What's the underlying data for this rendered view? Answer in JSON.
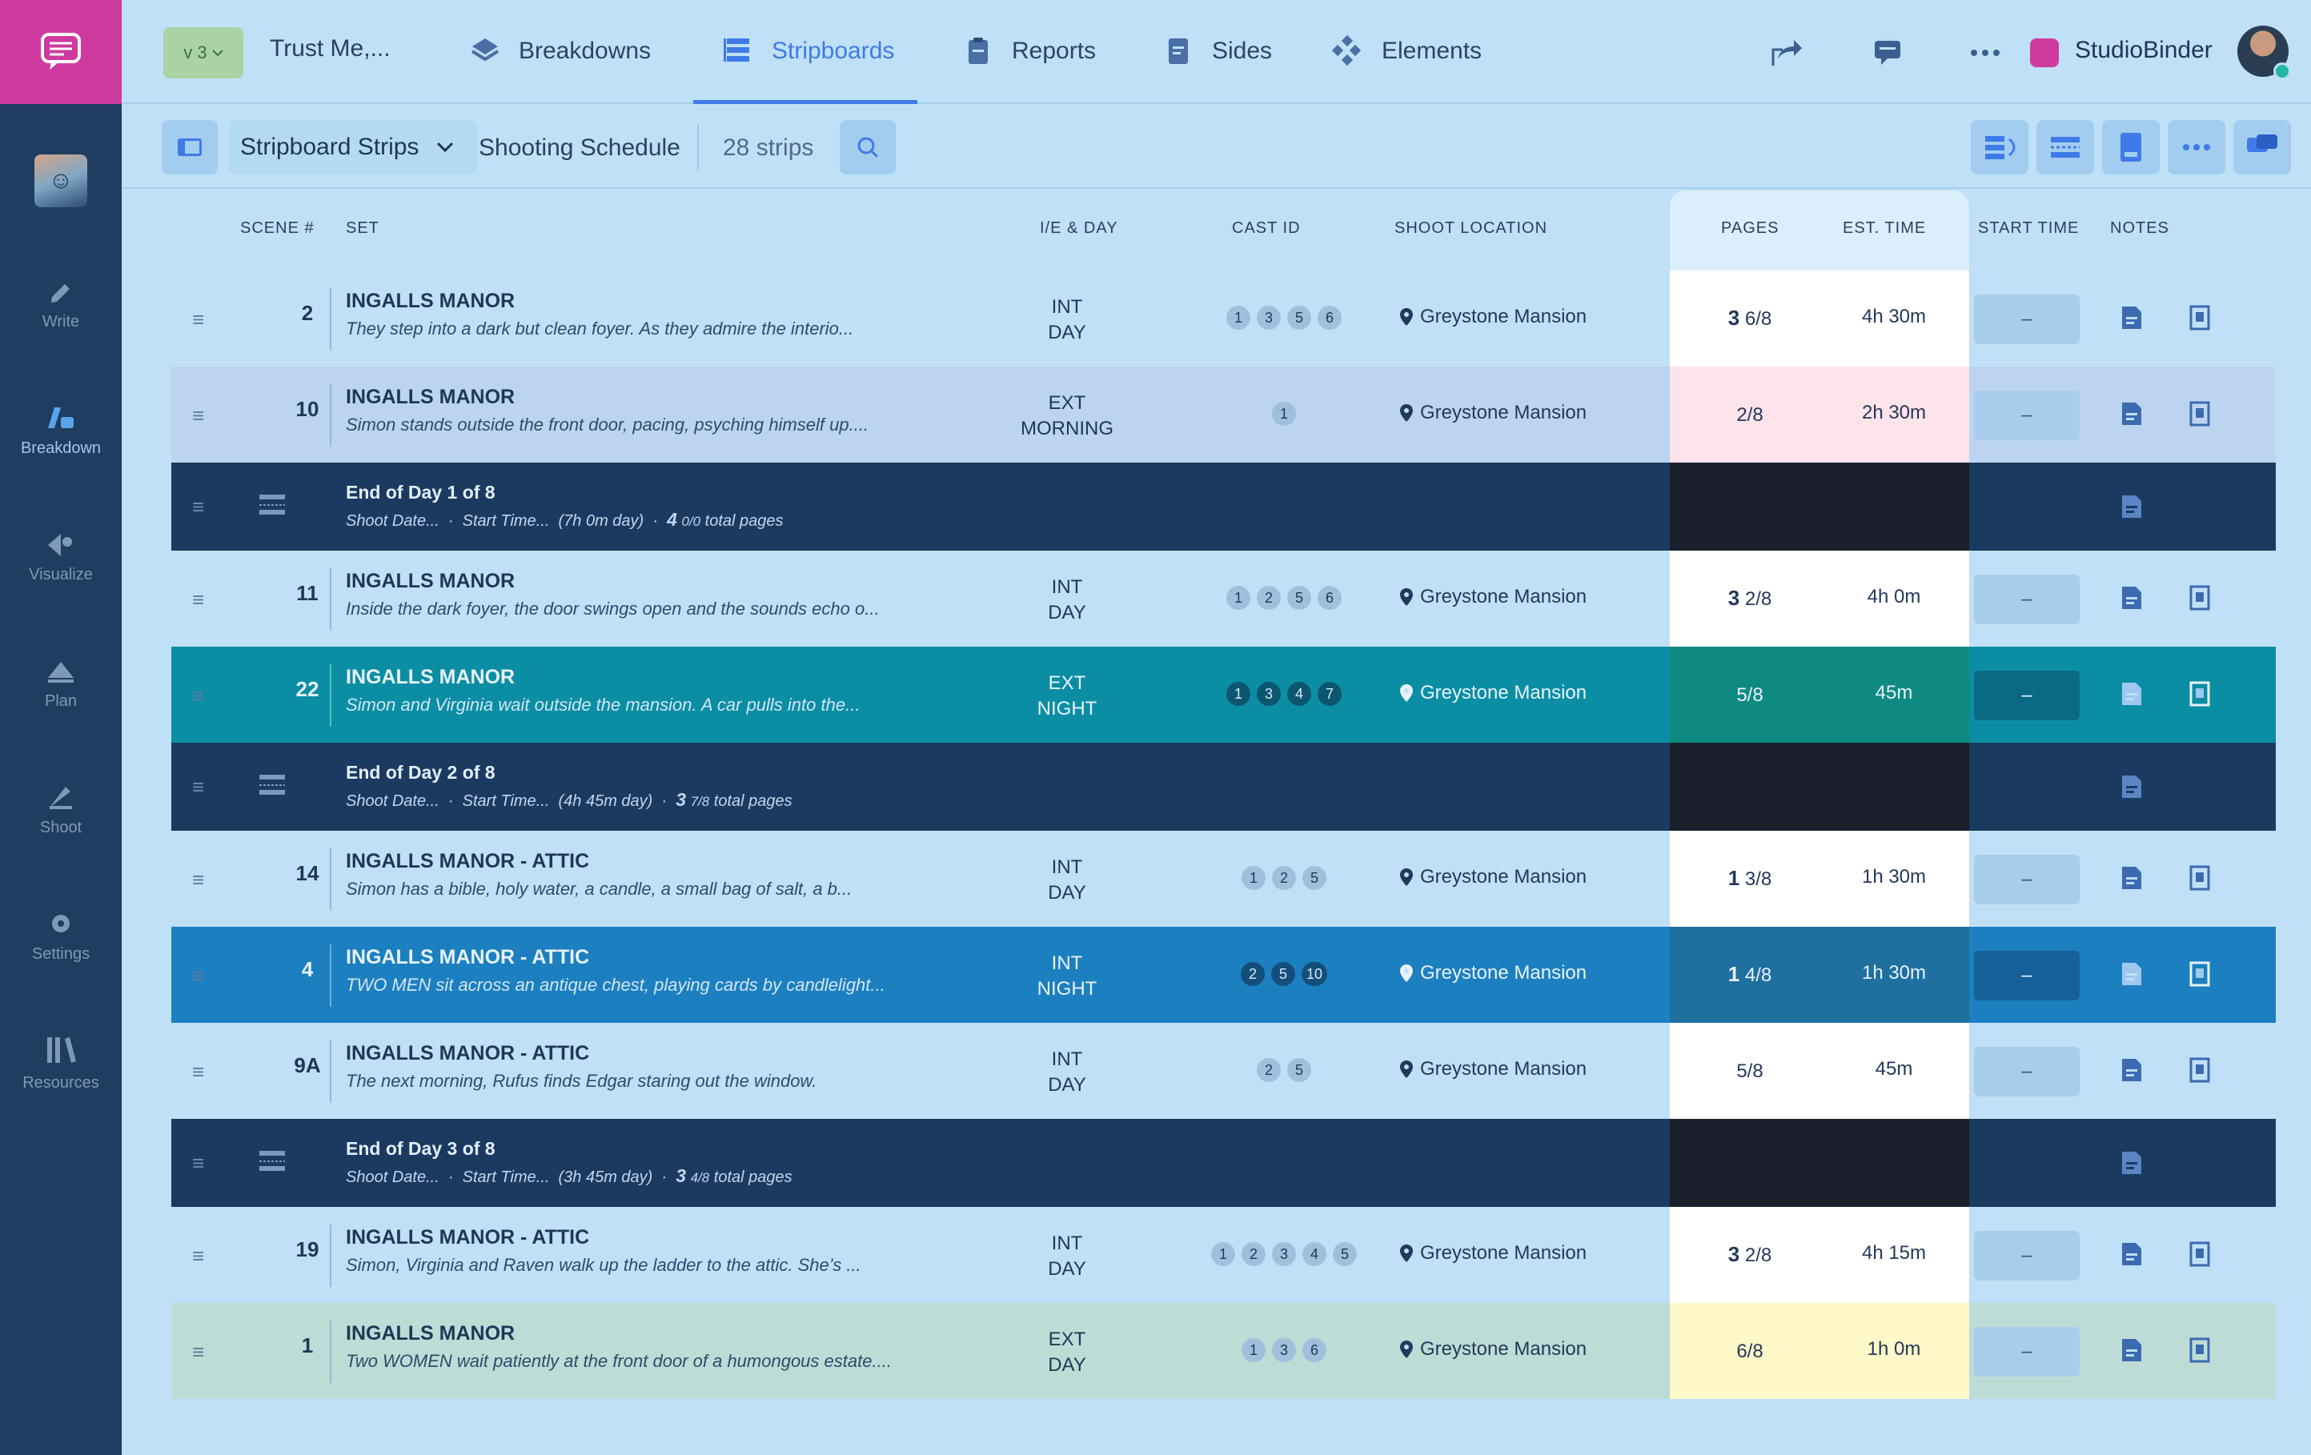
{
  "app": {
    "version": "v 3",
    "project": "Trust Me,..."
  },
  "tabs": [
    {
      "label": "Breakdowns"
    },
    {
      "label": "Stripboards"
    },
    {
      "label": "Reports"
    },
    {
      "label": "Sides"
    },
    {
      "label": "Elements"
    }
  ],
  "workspace": "StudioBinder",
  "nav": [
    {
      "label": "Write"
    },
    {
      "label": "Breakdown"
    },
    {
      "label": "Visualize"
    },
    {
      "label": "Plan"
    },
    {
      "label": "Shoot"
    },
    {
      "label": "Settings"
    },
    {
      "label": "Resources"
    }
  ],
  "toolbar": {
    "view": "Stripboard Strips",
    "schedule": "Shooting Schedule",
    "count": "28 strips"
  },
  "columns": {
    "scene": "SCENE #",
    "set": "SET",
    "ie": "I/E & DAY",
    "cast": "CAST ID",
    "location": "SHOOT LOCATION",
    "pages": "PAGES",
    "est": "EST. TIME",
    "start": "START TIME",
    "notes": "NOTES"
  },
  "rows": [
    {
      "kind": "scene",
      "scene": "2",
      "set": "INGALLS MANOR",
      "desc": "They step into a dark but clean foyer. As they admire the interio...",
      "ie": "INT",
      "time": "DAY",
      "cast": [
        "1",
        "3",
        "5",
        "6"
      ],
      "location": "Greystone Mansion",
      "pages_whole": "3",
      "pages_frac": "6/8",
      "est": "4h 30m",
      "start": "–",
      "bg": "#bfe0f7",
      "pages_bg": "#ffffff",
      "dark": false
    },
    {
      "kind": "scene",
      "scene": "10",
      "set": "INGALLS MANOR",
      "desc": "Simon stands outside the front door, pacing, psyching himself up....",
      "ie": "EXT",
      "time": "MORNING",
      "cast": [
        "1"
      ],
      "location": "Greystone Mansion",
      "pages_whole": "",
      "pages_frac": "2/8",
      "est": "2h 30m",
      "start": "–",
      "bg": "#bdd4f1",
      "pages_bg": "#fde3ea",
      "dark": false
    },
    {
      "kind": "break",
      "title": "End of  Day 1 of 8",
      "shoot_date": "Shoot Date...",
      "start_time": "Start Time...",
      "duration": "(7h 0m day)",
      "total_whole": "4",
      "total_frac": "0/0",
      "total_label": "total pages"
    },
    {
      "kind": "scene",
      "scene": "11",
      "set": "INGALLS MANOR",
      "desc": "Inside the dark foyer, the door swings open and the sounds echo o...",
      "ie": "INT",
      "time": "DAY",
      "cast": [
        "1",
        "2",
        "5",
        "6"
      ],
      "location": "Greystone Mansion",
      "pages_whole": "3",
      "pages_frac": "2/8",
      "est": "4h 0m",
      "start": "–",
      "bg": "#bfe0f7",
      "pages_bg": "#ffffff",
      "dark": false
    },
    {
      "kind": "scene",
      "scene": "22",
      "set": "INGALLS MANOR",
      "desc": "Simon and Virginia wait outside the mansion. A car pulls into the...",
      "ie": "EXT",
      "time": "NIGHT",
      "cast": [
        "1",
        "3",
        "4",
        "7"
      ],
      "location": "Greystone Mansion",
      "pages_whole": "",
      "pages_frac": "5/8",
      "est": "45m",
      "start": "–",
      "bg": "#0b8ea3",
      "pages_bg": "#0f8a83",
      "dark": true
    },
    {
      "kind": "break",
      "title": "End of  Day 2 of 8",
      "shoot_date": "Shoot Date...",
      "start_time": "Start Time...",
      "duration": "(4h 45m day)",
      "total_whole": "3",
      "total_frac": "7/8",
      "total_label": "total pages"
    },
    {
      "kind": "scene",
      "scene": "14",
      "set": "INGALLS MANOR - ATTIC",
      "desc": "Simon has a bible, holy water, a candle, a small bag of salt, a b...",
      "ie": "INT",
      "time": "DAY",
      "cast": [
        "1",
        "2",
        "5"
      ],
      "location": "Greystone Mansion",
      "pages_whole": "1",
      "pages_frac": "3/8",
      "est": "1h 30m",
      "start": "–",
      "bg": "#bfe0f7",
      "pages_bg": "#ffffff",
      "dark": false
    },
    {
      "kind": "scene",
      "scene": "4",
      "set": "INGALLS MANOR - ATTIC",
      "desc": "TWO MEN sit across an antique chest, playing cards by candlelight...",
      "ie": "INT",
      "time": "NIGHT",
      "cast": [
        "2",
        "5",
        "10"
      ],
      "location": "Greystone Mansion",
      "pages_whole": "1",
      "pages_frac": "4/8",
      "est": "1h 30m",
      "start": "–",
      "bg": "#1c7fbf",
      "pages_bg": "#1f6f9f",
      "dark": true
    },
    {
      "kind": "scene",
      "scene": "9A",
      "set": "INGALLS MANOR - ATTIC",
      "desc": "The next morning, Rufus finds Edgar staring out the window.",
      "ie": "INT",
      "time": "DAY",
      "cast": [
        "2",
        "5"
      ],
      "location": "Greystone Mansion",
      "pages_whole": "",
      "pages_frac": "5/8",
      "est": "45m",
      "start": "–",
      "bg": "#bfe0f7",
      "pages_bg": "#ffffff",
      "dark": false
    },
    {
      "kind": "break",
      "title": "End of  Day 3 of 8",
      "shoot_date": "Shoot Date...",
      "start_time": "Start Time...",
      "duration": "(3h 45m day)",
      "total_whole": "3",
      "total_frac": "4/8",
      "total_label": "total pages"
    },
    {
      "kind": "scene",
      "scene": "19",
      "set": "INGALLS MANOR - ATTIC",
      "desc": "Simon, Virginia and Raven walk up the ladder to the attic. She’s ...",
      "ie": "INT",
      "time": "DAY",
      "cast": [
        "1",
        "2",
        "3",
        "4",
        "5"
      ],
      "location": "Greystone Mansion",
      "pages_whole": "3",
      "pages_frac": "2/8",
      "est": "4h 15m",
      "start": "–",
      "bg": "#bfe0f7",
      "pages_bg": "#ffffff",
      "dark": false
    },
    {
      "kind": "scene",
      "scene": "1",
      "set": "INGALLS MANOR",
      "desc": "Two WOMEN wait patiently at the front door of a humongous estate....",
      "ie": "EXT",
      "time": "DAY",
      "cast": [
        "1",
        "3",
        "6"
      ],
      "location": "Greystone Mansion",
      "pages_whole": "",
      "pages_frac": "6/8",
      "est": "1h 0m",
      "start": "–",
      "bg": "#bedcd6",
      "pages_bg": "#fff8c9",
      "dark": false
    }
  ]
}
